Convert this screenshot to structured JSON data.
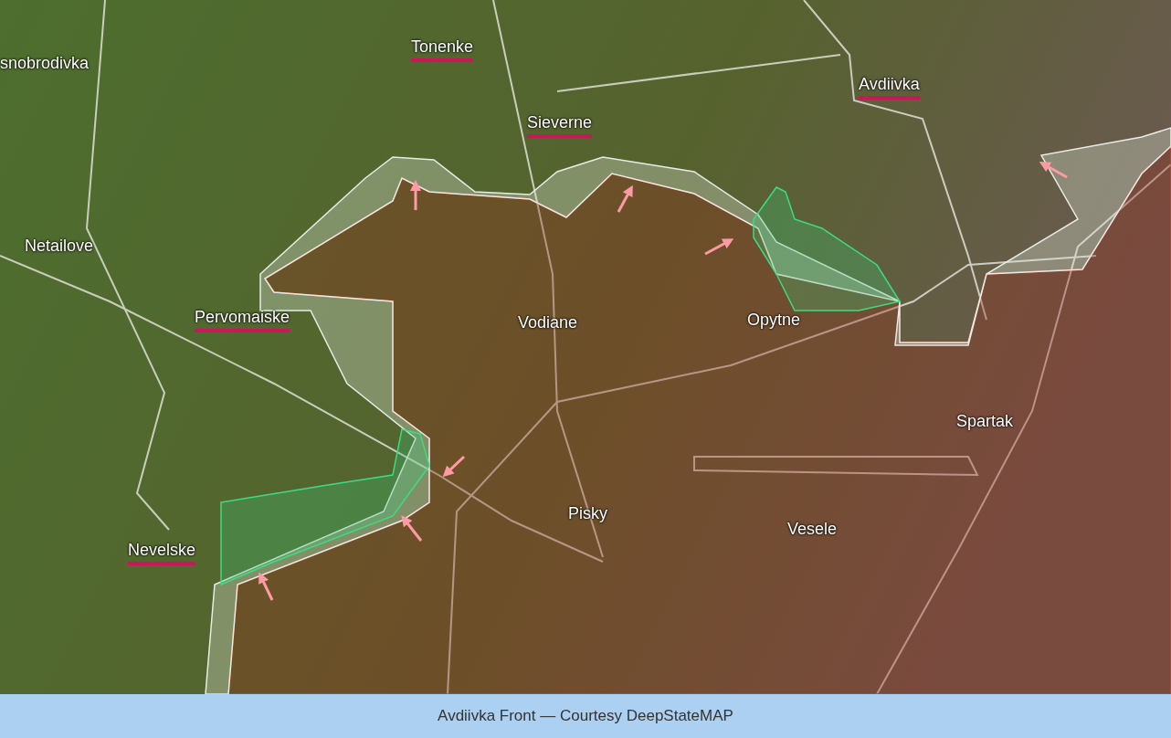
{
  "map": {
    "places": [
      {
        "name": "snobrodivka",
        "underlined": false
      },
      {
        "name": "Tonenke",
        "underlined": true
      },
      {
        "name": "Sieverne",
        "underlined": true
      },
      {
        "name": "Avdiivka",
        "underlined": true
      },
      {
        "name": "Netailove",
        "underlined": false
      },
      {
        "name": "Pervomaiske",
        "underlined": true
      },
      {
        "name": "Vodiane",
        "underlined": false
      },
      {
        "name": "Opytne",
        "underlined": false
      },
      {
        "name": "Spartak",
        "underlined": false
      },
      {
        "name": "Pisky",
        "underlined": false
      },
      {
        "name": "Vesele",
        "underlined": false
      },
      {
        "name": "Nevelske",
        "underlined": true
      }
    ]
  },
  "caption": "Avdiivka Front — Courtesy DeepStateMAP"
}
